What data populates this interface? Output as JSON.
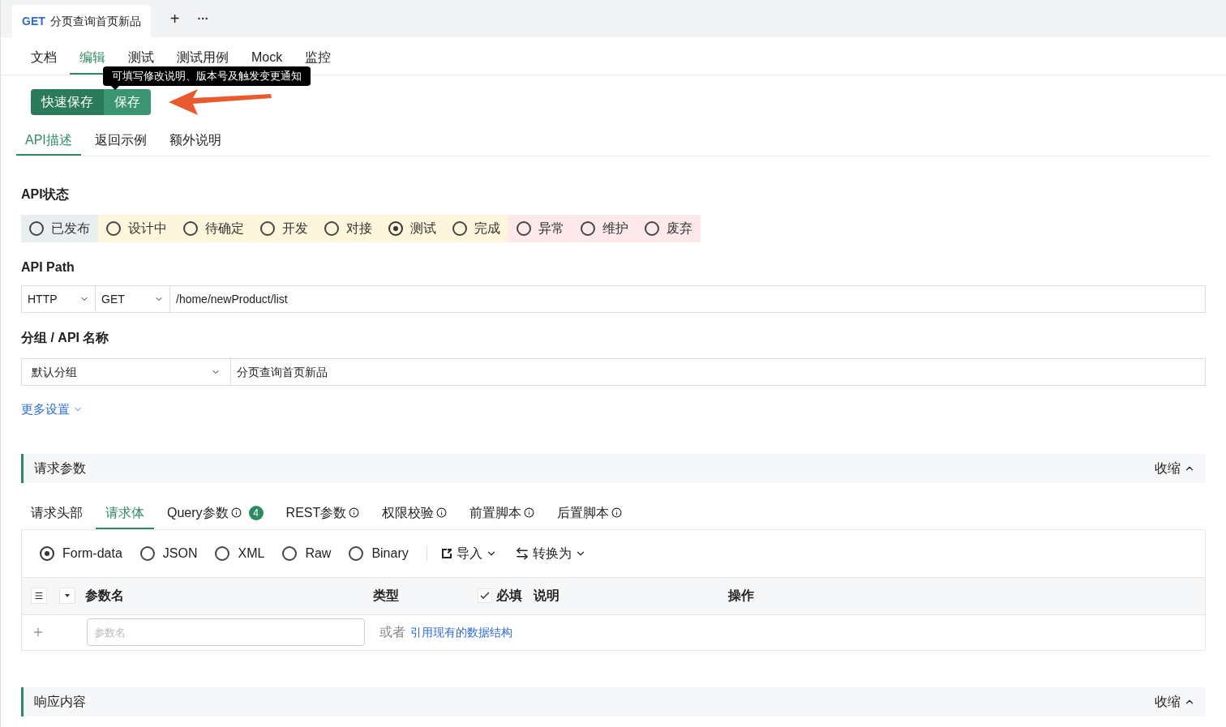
{
  "doc_tab": {
    "method": "GET",
    "title": "分页查询首页新品",
    "add": "+",
    "more": "···"
  },
  "top_tabs": [
    {
      "label": "文档",
      "selected": false
    },
    {
      "label": "编辑",
      "selected": true
    },
    {
      "label": "测试",
      "selected": false
    },
    {
      "label": "测试用例",
      "selected": false
    },
    {
      "label": "Mock",
      "selected": false
    },
    {
      "label": "监控",
      "selected": false
    }
  ],
  "tooltip": "可填写修改说明、版本号及触发变更通知",
  "save_buttons": [
    "快速保存",
    "保存"
  ],
  "section_tabs": [
    {
      "label": "API描述",
      "selected": true
    },
    {
      "label": "返回示例",
      "selected": false
    },
    {
      "label": "额外说明",
      "selected": false
    }
  ],
  "status": {
    "label": "API状态",
    "options": [
      {
        "label": "已发布",
        "selected": false,
        "color": "#e9eff1"
      },
      {
        "label": "设计中",
        "selected": false,
        "color": "#fdf6dc"
      },
      {
        "label": "待确定",
        "selected": false,
        "color": "#fdf6dc"
      },
      {
        "label": "开发",
        "selected": false,
        "color": "#fdf6dc"
      },
      {
        "label": "对接",
        "selected": false,
        "color": "#fdf6dc"
      },
      {
        "label": "测试",
        "selected": true,
        "color": "#fdf6dc"
      },
      {
        "label": "完成",
        "selected": false,
        "color": "#fdf6dc"
      },
      {
        "label": "异常",
        "selected": false,
        "color": "#fde8ea"
      },
      {
        "label": "维护",
        "selected": false,
        "color": "#fde8ea"
      },
      {
        "label": "废弃",
        "selected": false,
        "color": "#fde8ea"
      }
    ]
  },
  "api_path": {
    "label": "API Path",
    "protocol": "HTTP",
    "method": "GET",
    "path": "/home/newProduct/list"
  },
  "group_name": {
    "label": "分组 / API 名称",
    "group": "默认分组",
    "name": "分页查询首页新品"
  },
  "more_settings": "更多设置",
  "request_params": {
    "title": "请求参数",
    "collapse": "收缩",
    "tabs": [
      {
        "label": "请求头部",
        "selected": false,
        "info": false
      },
      {
        "label": "请求体",
        "selected": true,
        "info": false
      },
      {
        "label": "Query参数",
        "selected": false,
        "info": true,
        "badge": "4"
      },
      {
        "label": "REST参数",
        "selected": false,
        "info": true
      },
      {
        "label": "权限校验",
        "selected": false,
        "info": true
      },
      {
        "label": "前置脚本",
        "selected": false,
        "info": true
      },
      {
        "label": "后置脚本",
        "selected": false,
        "info": true
      }
    ],
    "body_types": [
      {
        "label": "Form-data",
        "selected": true
      },
      {
        "label": "JSON",
        "selected": false
      },
      {
        "label": "XML",
        "selected": false
      },
      {
        "label": "Raw",
        "selected": false
      },
      {
        "label": "Binary",
        "selected": false
      }
    ],
    "import": "导入",
    "convert": "转换为",
    "columns": [
      "参数名",
      "类型",
      "必填",
      "说明",
      "操作"
    ],
    "required_checked": true,
    "name_placeholder": "参数名",
    "or": "或者",
    "ref_link": "引用现有的数据结构"
  },
  "response": {
    "title": "响应内容",
    "collapse": "收缩"
  }
}
